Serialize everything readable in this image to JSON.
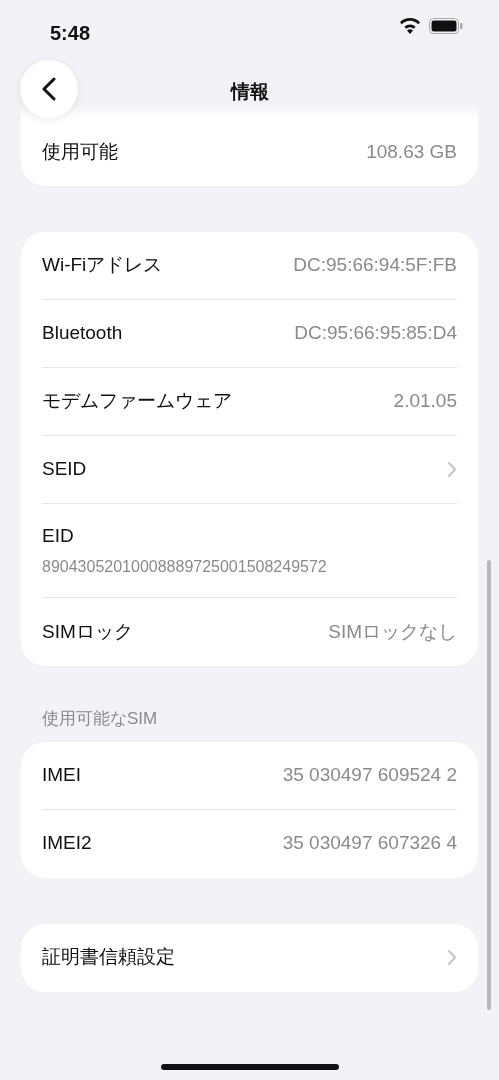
{
  "status_bar": {
    "time": "5:48"
  },
  "nav": {
    "title": "情報"
  },
  "groups": [
    {
      "rows": [
        {
          "kind": "value",
          "label": "使用可能",
          "value": "108.63 GB"
        }
      ]
    },
    {
      "rows": [
        {
          "kind": "value",
          "label": "Wi-Fiアドレス",
          "value": "DC:95:66:94:5F:FB"
        },
        {
          "kind": "value",
          "label": "Bluetooth",
          "value": "DC:95:66:95:85:D4"
        },
        {
          "kind": "value",
          "label": "モデムファームウェア",
          "value": "2.01.05"
        },
        {
          "kind": "chevron",
          "label": "SEID"
        },
        {
          "kind": "stacked",
          "label": "EID",
          "value": "89043052010008889725001508249572"
        },
        {
          "kind": "value",
          "label": "SIMロック",
          "value": "SIMロックなし"
        }
      ]
    },
    {
      "header": "使用可能なSIM",
      "rows": [
        {
          "kind": "value",
          "label": "IMEI",
          "value": "35 030497 609524 2"
        },
        {
          "kind": "value",
          "label": "IMEI2",
          "value": "35 030497 607326 4"
        }
      ]
    },
    {
      "rows": [
        {
          "kind": "chevron",
          "label": "証明書信頼設定"
        }
      ]
    }
  ]
}
